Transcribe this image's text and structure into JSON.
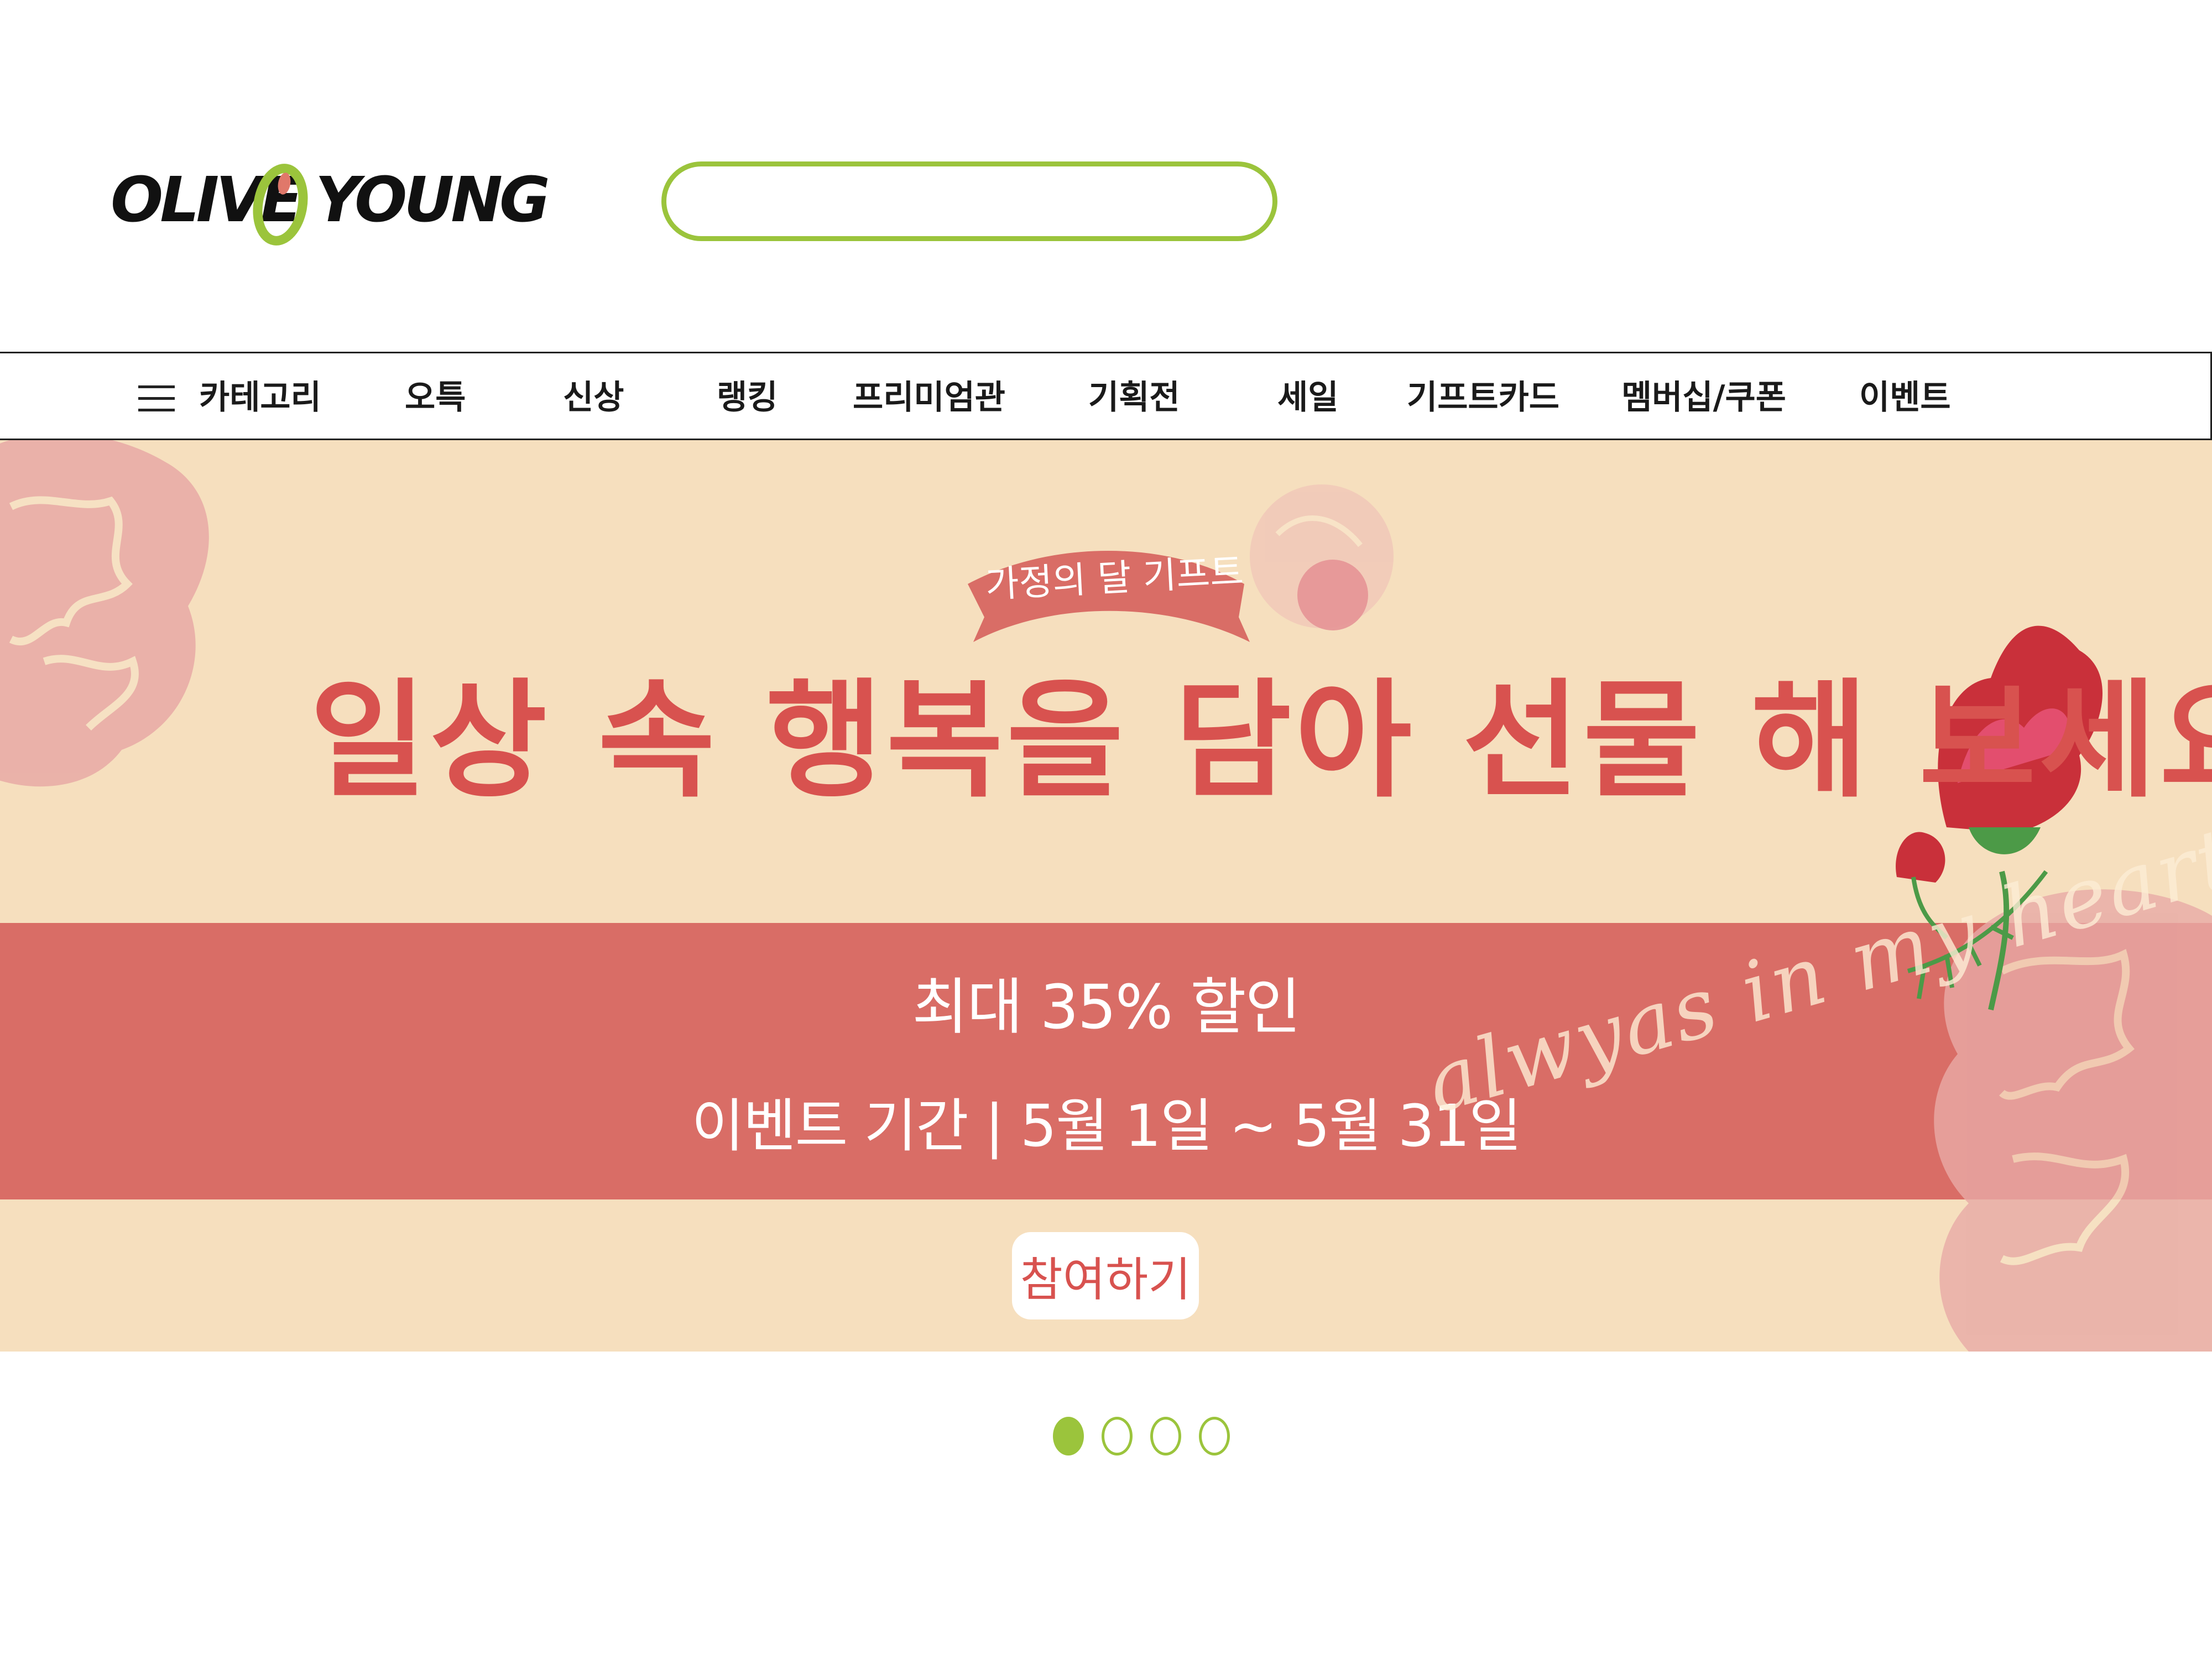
{
  "brand": {
    "logo_left": "OLIVE",
    "logo_right": "YOUNG",
    "green": "#9bc43c",
    "olive_dot": "#e0786a"
  },
  "search": {
    "placeholder": "",
    "value": ""
  },
  "nav": {
    "menu_icon": "hamburger-icon",
    "items": [
      {
        "label": "카테고리"
      },
      {
        "label": "오특"
      },
      {
        "label": "신상"
      },
      {
        "label": "랭킹"
      },
      {
        "label": "프리미엄관"
      },
      {
        "label": "기획전"
      },
      {
        "label": "세일"
      },
      {
        "label": "기프트카드"
      },
      {
        "label": "멤버십/쿠폰"
      },
      {
        "label": "이벤트"
      }
    ]
  },
  "banner": {
    "badge": "가정의 달 기프트",
    "headline": "일상 속 행복을 담아 선물 해 보세요!",
    "discount": "최대 35% 할인",
    "period": "이벤트 기간 | 5월 1일 ~ 5월 31일",
    "cta": "참여하기",
    "script_text": "alwyas in my heart",
    "colors": {
      "background": "#f6dfbe",
      "band": "#d96d66",
      "headline": "#d8524f",
      "carnation": "#c9303a"
    }
  },
  "pagination": {
    "count": 4,
    "active_index": 0
  }
}
